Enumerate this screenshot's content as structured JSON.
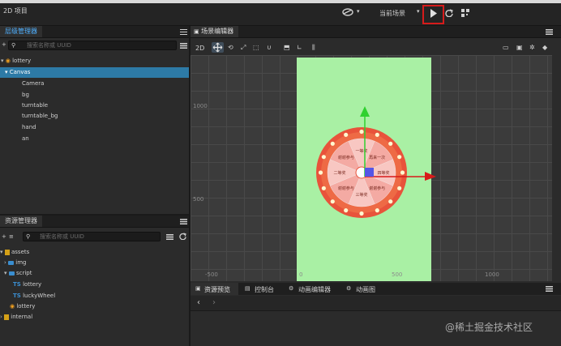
{
  "app": {
    "title": "2D 项目",
    "scene_select": "当前场景"
  },
  "hierarchy": {
    "tab": "层级管理器",
    "search_placeholder": "搜索名称或 UUID",
    "nodes": [
      {
        "label": "lottery",
        "depth": 0
      },
      {
        "label": "Canvas",
        "depth": 1,
        "selected": true
      },
      {
        "label": "Camera",
        "depth": 2
      },
      {
        "label": "bg",
        "depth": 2
      },
      {
        "label": "turntable",
        "depth": 2
      },
      {
        "label": "turntable_bg",
        "depth": 2
      },
      {
        "label": "hand",
        "depth": 2
      },
      {
        "label": "an",
        "depth": 2
      }
    ]
  },
  "assets": {
    "tab": "资源管理器",
    "search_placeholder": "搜索名称或 UUID",
    "items": [
      {
        "label": "assets",
        "depth": 0,
        "icon": "db-icon"
      },
      {
        "label": "img",
        "depth": 1,
        "icon": "folder-icon"
      },
      {
        "label": "script",
        "depth": 1,
        "icon": "folder-icon"
      },
      {
        "label": "lottery",
        "depth": 2,
        "icon": "ts-icon"
      },
      {
        "label": "luckyWheel",
        "depth": 2,
        "icon": "ts-icon"
      },
      {
        "label": "lottery",
        "depth": 1,
        "icon": "scene-icon"
      },
      {
        "label": "internal",
        "depth": 0,
        "icon": "db-icon"
      }
    ]
  },
  "scene": {
    "tab": "场景编辑器",
    "mode": "2D",
    "axis_labels": {
      "y_top": "1000",
      "y_mid": "500",
      "x_left": "-500",
      "x_zero": "0",
      "x_mid": "500",
      "x_right": "1000"
    }
  },
  "wheel": {
    "segments": [
      "一等奖",
      "再来一次",
      "四等奖",
      "谢谢参与",
      "三等奖",
      "谢谢参与",
      "二等奖",
      "谢谢参与"
    ],
    "colors": {
      "ring": "#e8533b",
      "inner": "#f8c7c2",
      "slice_alt": "#f4aaa3"
    }
  },
  "bottom": {
    "tabs": [
      "资源预览",
      "控制台",
      "动画编辑器",
      "动画图"
    ]
  },
  "watermark": "@稀土掘金技术社区"
}
